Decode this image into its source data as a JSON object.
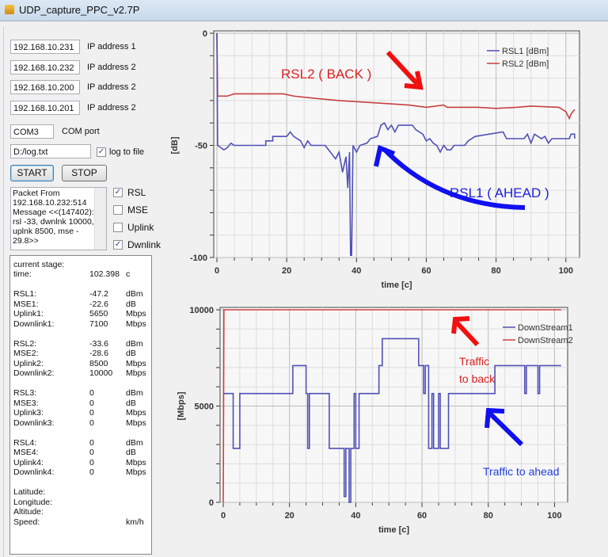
{
  "window": {
    "title": "UDP_capture_PPC_v2.7P"
  },
  "ips": [
    {
      "value": "192.168.10.231",
      "label": "IP address 1"
    },
    {
      "value": "192.168.10.232",
      "label": "IP address 2"
    },
    {
      "value": "192.168.10.200",
      "label": "IP address 2"
    },
    {
      "value": "192.168.10.201",
      "label": "IP address 2"
    }
  ],
  "com": {
    "value": "COM3",
    "label": "COM port"
  },
  "logfile": {
    "value": "D:/log.txt",
    "label": "log to file",
    "checked": true
  },
  "buttons": {
    "start": "START",
    "stop": "STOP"
  },
  "log_lines": [
    "Packet From",
    "192.168.10.232:514",
    "Message <<(147402):",
    "rsl -33, dwnlnk 10000,",
    "uplnk 8500, mse -",
    "29.8>>"
  ],
  "checks": [
    {
      "label": "RSL",
      "checked": true
    },
    {
      "label": "MSE",
      "checked": false
    },
    {
      "label": "Uplink",
      "checked": false
    },
    {
      "label": "Dwnlink",
      "checked": true
    }
  ],
  "info": {
    "header": "current stage:",
    "time": {
      "label": "time:",
      "value": "102.398",
      "unit": "c"
    },
    "groups": [
      [
        [
          "RSL1:",
          "-47.2",
          "dBm"
        ],
        [
          "MSE1:",
          "-22.6",
          "dB"
        ],
        [
          "Uplink1:",
          "5650",
          "Mbps"
        ],
        [
          "Downlink1:",
          "7100",
          "Mbps"
        ]
      ],
      [
        [
          "RSL2:",
          "-33.6",
          "dBm"
        ],
        [
          "MSE2:",
          "-28.6",
          "dB"
        ],
        [
          "Uplink2:",
          "8500",
          "Mbps"
        ],
        [
          "Downlink2:",
          "10000",
          "Mbps"
        ]
      ],
      [
        [
          "RSL3:",
          "0",
          "dBm"
        ],
        [
          "MSE3:",
          "0",
          "dB"
        ],
        [
          "Uplink3:",
          "0",
          "Mbps"
        ],
        [
          "Downlink3:",
          "0",
          "Mbps"
        ]
      ],
      [
        [
          "RSL4:",
          "0",
          "dBm"
        ],
        [
          "MSE4:",
          "0",
          "dB"
        ],
        [
          "Uplink4:",
          "0",
          "Mbps"
        ],
        [
          "Downlink4:",
          "0",
          "Mbps"
        ]
      ]
    ],
    "gps": [
      [
        "Latitude:",
        ""
      ],
      [
        "Longitude:",
        ""
      ],
      [
        "Altitude:",
        ""
      ],
      [
        "Speed:",
        "km/h"
      ]
    ]
  },
  "chart_data": [
    {
      "type": "line",
      "xlabel": "time [c]",
      "ylabel": "[dB]",
      "xlim": [
        0,
        103
      ],
      "ylim": [
        -100,
        0
      ],
      "xticks": [
        0,
        20,
        40,
        60,
        80,
        100
      ],
      "yticks": [
        0,
        -50,
        -100
      ],
      "grid": true,
      "legend": "top-right",
      "annotations": [
        {
          "text": "RSL2 ( BACK )",
          "color": "#e02020"
        },
        {
          "text": "RSL1 ( AHEAD )",
          "color": "#2020e0"
        }
      ],
      "series": [
        {
          "name": "RSL1 [dBm]",
          "color": "#5050b8",
          "points": [
            [
              0,
              0
            ],
            [
              0.2,
              -50
            ],
            [
              2,
              -52
            ],
            [
              3,
              -51
            ],
            [
              4,
              -49
            ],
            [
              5,
              -50
            ],
            [
              14,
              -50
            ],
            [
              14,
              -48
            ],
            [
              16,
              -48
            ],
            [
              16,
              -46
            ],
            [
              20,
              -46
            ],
            [
              21,
              -44
            ],
            [
              22,
              -46
            ],
            [
              24,
              -48
            ],
            [
              25,
              -51
            ],
            [
              26,
              -48
            ],
            [
              27,
              -50
            ],
            [
              31,
              -50
            ],
            [
              32,
              -52
            ],
            [
              33,
              -54
            ],
            [
              34,
              -56
            ],
            [
              35,
              -53
            ],
            [
              36,
              -62
            ],
            [
              37,
              -55
            ],
            [
              37.5,
              -69
            ],
            [
              38,
              -53
            ],
            [
              38.3,
              -99
            ],
            [
              38.6,
              -99
            ],
            [
              39,
              -50
            ],
            [
              40,
              -53
            ],
            [
              41,
              -50
            ],
            [
              43,
              -49
            ],
            [
              44,
              -47
            ],
            [
              46,
              -46
            ],
            [
              47,
              -41
            ],
            [
              48,
              -40
            ],
            [
              49,
              -43
            ],
            [
              50,
              -41
            ],
            [
              51,
              -44
            ],
            [
              52,
              -41
            ],
            [
              56,
              -41
            ],
            [
              57,
              -43
            ],
            [
              59,
              -45
            ],
            [
              60,
              -48
            ],
            [
              61,
              -47
            ],
            [
              62,
              -49
            ],
            [
              63,
              -50
            ],
            [
              64,
              -53
            ],
            [
              65,
              -50
            ],
            [
              66,
              -52
            ],
            [
              67,
              -52
            ],
            [
              68,
              -50
            ],
            [
              71,
              -50
            ],
            [
              72,
              -48
            ],
            [
              74,
              -46
            ],
            [
              82,
              -44
            ],
            [
              83,
              -47
            ],
            [
              88,
              -47
            ],
            [
              89,
              -45
            ],
            [
              90,
              -49
            ],
            [
              91,
              -45
            ],
            [
              93,
              -47
            ],
            [
              94,
              -46
            ],
            [
              95,
              -49
            ],
            [
              96,
              -47
            ],
            [
              101,
              -47
            ],
            [
              101.5,
              -45
            ],
            [
              102.5,
              -45
            ],
            [
              102.5,
              -47
            ]
          ]
        },
        {
          "name": "RSL2 [dBm]",
          "color": "#c84040",
          "points": [
            [
              0,
              0
            ],
            [
              0.2,
              -28
            ],
            [
              3,
              -28
            ],
            [
              5,
              -27
            ],
            [
              19,
              -27
            ],
            [
              22,
              -28
            ],
            [
              28,
              -29
            ],
            [
              35,
              -30
            ],
            [
              45,
              -31
            ],
            [
              55,
              -32
            ],
            [
              60,
              -33
            ],
            [
              65,
              -32
            ],
            [
              66,
              -33
            ],
            [
              75,
              -33
            ],
            [
              80,
              -33.5
            ],
            [
              86,
              -33
            ],
            [
              90,
              -32.5
            ],
            [
              98,
              -33
            ],
            [
              100,
              -35
            ],
            [
              101,
              -38
            ],
            [
              101.5,
              -36
            ],
            [
              102.5,
              -34
            ]
          ]
        }
      ]
    },
    {
      "type": "line",
      "xlabel": "time [c]",
      "ylabel": "[Mbps]",
      "xlim": [
        0,
        103
      ],
      "ylim": [
        0,
        10000
      ],
      "xticks": [
        0,
        20,
        40,
        60,
        80,
        100
      ],
      "yticks": [
        0,
        5000,
        10000
      ],
      "grid": true,
      "legend": "top-right",
      "annotations": [
        {
          "text": "Traffic",
          "color": "#e02020"
        },
        {
          "text": "to back",
          "color": "#e02020"
        },
        {
          "text": "Traffic to ahead",
          "color": "#2040e0"
        }
      ],
      "series": [
        {
          "name": "DownStream1",
          "color": "#5050b8",
          "points": [
            [
              0,
              5650
            ],
            [
              3,
              5650
            ],
            [
              3,
              2800
            ],
            [
              5,
              2800
            ],
            [
              5,
              5650
            ],
            [
              21,
              5650
            ],
            [
              21,
              7100
            ],
            [
              25,
              7100
            ],
            [
              25,
              5650
            ],
            [
              25.5,
              5650
            ],
            [
              25.5,
              2800
            ],
            [
              26,
              2800
            ],
            [
              26,
              5650
            ],
            [
              32,
              5650
            ],
            [
              32,
              2800
            ],
            [
              36.5,
              2800
            ],
            [
              36.5,
              300
            ],
            [
              37,
              300
            ],
            [
              37,
              2800
            ],
            [
              38,
              2800
            ],
            [
              38,
              0
            ],
            [
              38.5,
              0
            ],
            [
              38.5,
              2800
            ],
            [
              39.5,
              2800
            ],
            [
              39.5,
              5650
            ],
            [
              40,
              5650
            ],
            [
              40,
              2800
            ],
            [
              41,
              2800
            ],
            [
              41,
              5650
            ],
            [
              47,
              5650
            ],
            [
              47,
              7100
            ],
            [
              48,
              7100
            ],
            [
              48,
              8500
            ],
            [
              59,
              8500
            ],
            [
              59,
              7100
            ],
            [
              60.5,
              7100
            ],
            [
              60.5,
              5650
            ],
            [
              61,
              5650
            ],
            [
              61,
              7100
            ],
            [
              62,
              7100
            ],
            [
              62,
              2800
            ],
            [
              63,
              2800
            ],
            [
              63,
              5650
            ],
            [
              63.5,
              5650
            ],
            [
              63.5,
              2800
            ],
            [
              65,
              2800
            ],
            [
              65,
              5650
            ],
            [
              65.5,
              5650
            ],
            [
              65.5,
              2800
            ],
            [
              68,
              2800
            ],
            [
              68,
              5650
            ],
            [
              82,
              5650
            ],
            [
              82,
              7100
            ],
            [
              91,
              7100
            ],
            [
              91,
              5650
            ],
            [
              91.5,
              5650
            ],
            [
              91.5,
              7100
            ],
            [
              95,
              7100
            ],
            [
              95,
              5650
            ],
            [
              95.5,
              5650
            ],
            [
              95.5,
              7100
            ],
            [
              102,
              7100
            ]
          ]
        },
        {
          "name": "DownStream2",
          "color": "#d04040",
          "points": [
            [
              0,
              0
            ],
            [
              0.2,
              10000
            ],
            [
              102,
              10000
            ]
          ]
        }
      ]
    }
  ]
}
